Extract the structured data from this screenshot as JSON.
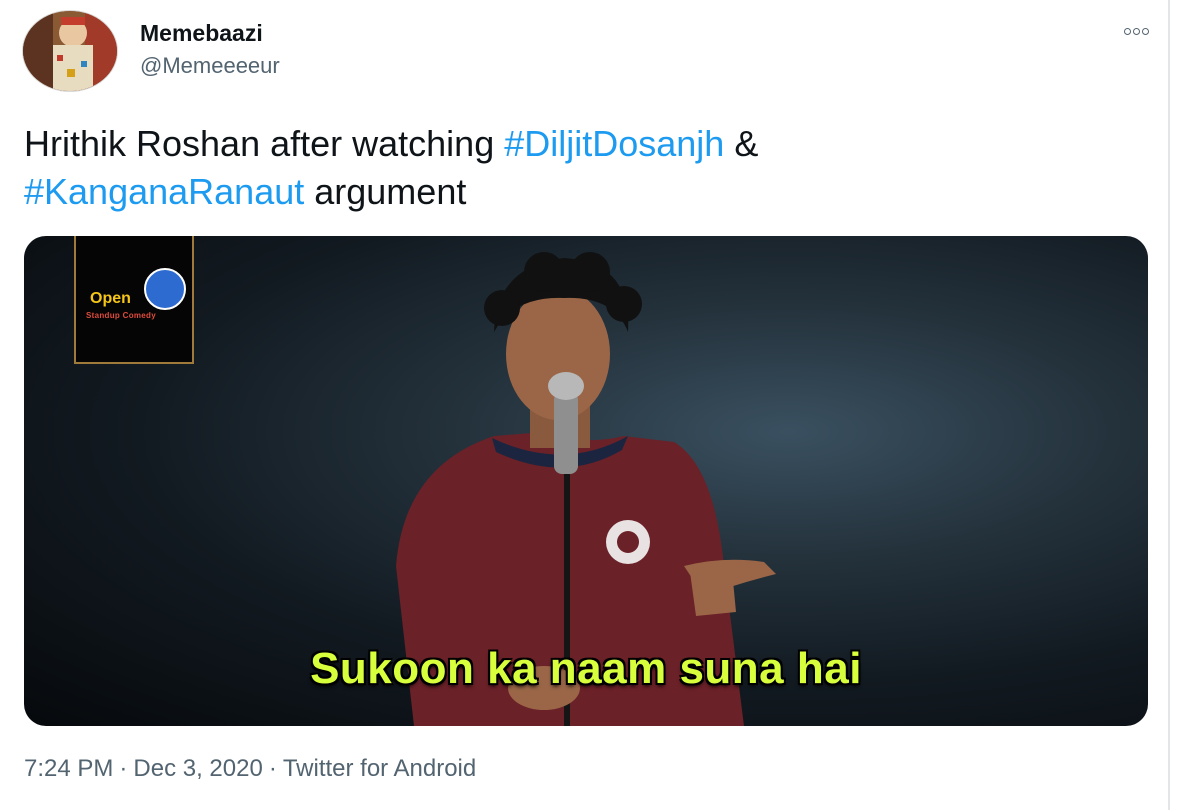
{
  "tweet": {
    "display_name": "Memebaazi",
    "handle": "@Memeeeeur",
    "text_parts": {
      "prefix": "Hrithik Roshan after watching ",
      "hashtag1": "#DiljitDosanjh",
      "middle": " & ",
      "hashtag2": "#KanganaRanaut",
      "suffix": " argument"
    },
    "media": {
      "caption": "Sukoon ka naam suna hai",
      "logo_text": "Open",
      "logo_sub": "Standup Comedy"
    },
    "meta": {
      "time": "7:24 PM",
      "date": "Dec 3, 2020",
      "source": "Twitter for Android"
    }
  },
  "icons": {
    "more": "more-options-icon",
    "avatar": "avatar"
  },
  "colors": {
    "hashtag": "#1d9bf0",
    "caption": "#d8ff3c",
    "meta_text": "#536471"
  }
}
